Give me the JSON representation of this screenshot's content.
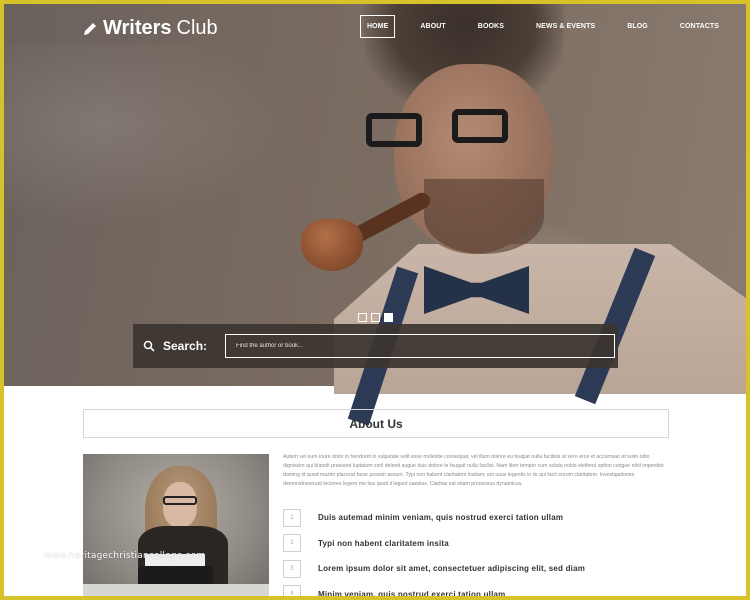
{
  "brand": {
    "bold": "Writers",
    "light": "Club",
    "icon": "pen-icon"
  },
  "nav": {
    "items": [
      {
        "label": "HOME",
        "active": true
      },
      {
        "label": "ABOUT",
        "active": false
      },
      {
        "label": "BOOKS",
        "active": false
      },
      {
        "label": "NEWS & EVENTS",
        "active": false
      },
      {
        "label": "BLOG",
        "active": false
      },
      {
        "label": "CONTACTS",
        "active": false
      }
    ]
  },
  "slider": {
    "slides": 3,
    "active_index": 3
  },
  "search": {
    "icon": "search-icon",
    "label": "Search:",
    "placeholder": "Find the author or book...",
    "value": ""
  },
  "about": {
    "title": "About Us",
    "paragraph": "Autem vel eum iriure dolor in hendrerit in vulputate velit esse molestie consequat, vel illum dolore eu feugiat nulla facilisis at vero eros et accumsan et iusto odio dignissim qui blandit praesent luptatum zzril delenit augue duis dolore te feugait nulla facilisi. Nam liber tempor cum soluta nobis eleifend option congue nihil imperdiet doming id quod mazim placerat facer possim assum. Typi non habent claritatem insitam; est usus legentis in iis qui facit eorum claritatem. Investigationes demonstraverunt lectores legere me lius quod ii legunt saepius. Claritas est etiam processus dynamicus.",
    "steps": [
      {
        "num": "1",
        "text": "Duis autemad minim veniam, quis nostrud exerci tation ullam"
      },
      {
        "num": "2",
        "text": "Typi non habent claritatem insita"
      },
      {
        "num": "3",
        "text": "Lorem ipsum dolor sit amet, consectetuer adipiscing elit, sed diam"
      },
      {
        "num": "4",
        "text": "Minim veniam, quis nostrud exerci tation ullam"
      }
    ]
  },
  "watermark": "www.heritagechristiancollege.com",
  "colors": {
    "frame": "#d8c22a",
    "search_bg": "#3c3430",
    "text_dark": "#333333"
  }
}
